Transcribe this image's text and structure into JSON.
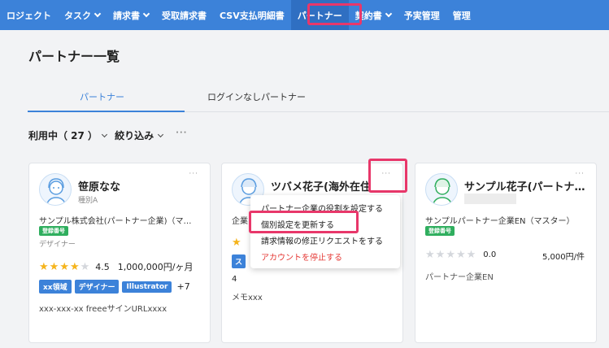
{
  "nav": {
    "items": [
      {
        "label": "ロジェクト",
        "chevron": false
      },
      {
        "label": "タスク",
        "chevron": true
      },
      {
        "label": "請求書",
        "chevron": true
      },
      {
        "label": "受取請求書",
        "chevron": false
      },
      {
        "label": "CSV支払明細書",
        "chevron": false
      },
      {
        "label": "パートナー",
        "chevron": false,
        "active": true
      },
      {
        "label": "契約書",
        "chevron": true
      },
      {
        "label": "予実管理",
        "chevron": false
      },
      {
        "label": "管理",
        "chevron": false
      }
    ]
  },
  "page": {
    "title": "パートナー一覧"
  },
  "tabs": {
    "partner": "パートナー",
    "nologin": "ログインなしパートナー"
  },
  "filters": {
    "status": "利用中（ 27 ）",
    "refine": "絞り込み",
    "more": "···"
  },
  "cards": [
    {
      "name": "笹原なな",
      "type": "種別A",
      "company": "サンプル株式会社(パートナー企業)（マ…",
      "badge": "登録番号",
      "role": "デザイナー",
      "stars_on": 4,
      "stars_total": 5,
      "rating": "4.5",
      "price": "1,000,000円/ヶ月",
      "tags": [
        "xx領域",
        "デザイナー",
        "Illustrator"
      ],
      "tags_more": "+7",
      "note": "xxx-xxx-xx freeeサインURLxxxx"
    },
    {
      "name": "ツバメ花子(海外在住",
      "company": "企業",
      "tag": "ス",
      "num": "4",
      "memo": "メモxxx"
    },
    {
      "name": "サンプル花子(パートナ…",
      "company": "サンプルパートナー企業EN（マスター）",
      "badge": "登録番号",
      "rating": "0.0",
      "price": "5,000円/件",
      "company_en": "パートナー企業EN"
    }
  ],
  "card_more": "···",
  "dropdown": {
    "items": [
      {
        "label": "パートナー企業の役割を設定する",
        "danger": false
      },
      {
        "label": "個別設定を更新する",
        "danger": false
      },
      {
        "label": "請求情報の修正リクエストをする",
        "danger": false
      },
      {
        "label": "アカウントを停止する",
        "danger": true
      }
    ]
  },
  "colors": {
    "nav_bg": "#3c82d9",
    "accent": "#3c82d9",
    "highlight": "#e8376a",
    "badge_green": "#2fae5e",
    "star": "#f5b41c",
    "danger": "#e53935"
  }
}
